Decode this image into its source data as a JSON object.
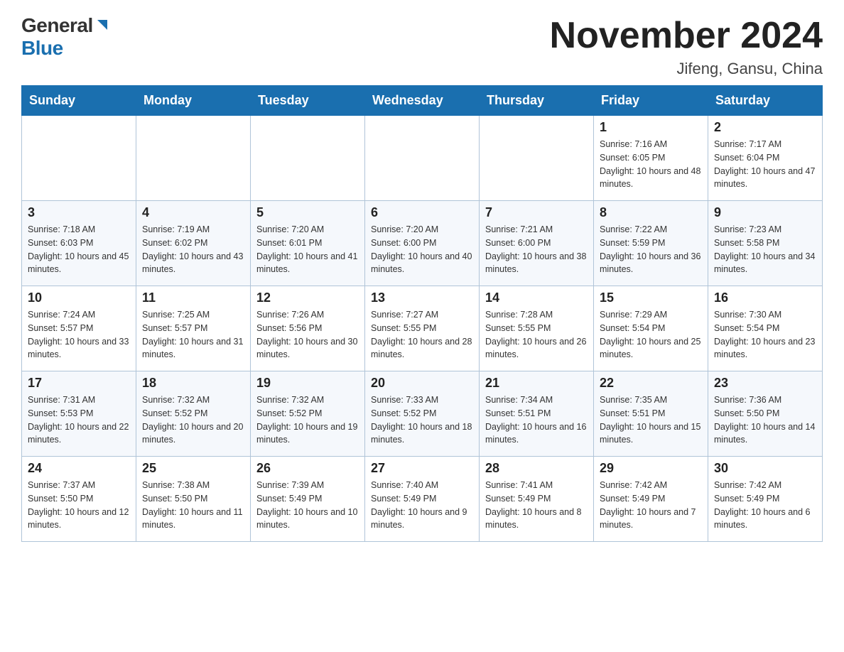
{
  "logo": {
    "general": "General",
    "blue": "Blue"
  },
  "title": "November 2024",
  "location": "Jifeng, Gansu, China",
  "weekdays": [
    "Sunday",
    "Monday",
    "Tuesday",
    "Wednesday",
    "Thursday",
    "Friday",
    "Saturday"
  ],
  "weeks": [
    [
      {
        "day": "",
        "info": ""
      },
      {
        "day": "",
        "info": ""
      },
      {
        "day": "",
        "info": ""
      },
      {
        "day": "",
        "info": ""
      },
      {
        "day": "",
        "info": ""
      },
      {
        "day": "1",
        "info": "Sunrise: 7:16 AM\nSunset: 6:05 PM\nDaylight: 10 hours and 48 minutes."
      },
      {
        "day": "2",
        "info": "Sunrise: 7:17 AM\nSunset: 6:04 PM\nDaylight: 10 hours and 47 minutes."
      }
    ],
    [
      {
        "day": "3",
        "info": "Sunrise: 7:18 AM\nSunset: 6:03 PM\nDaylight: 10 hours and 45 minutes."
      },
      {
        "day": "4",
        "info": "Sunrise: 7:19 AM\nSunset: 6:02 PM\nDaylight: 10 hours and 43 minutes."
      },
      {
        "day": "5",
        "info": "Sunrise: 7:20 AM\nSunset: 6:01 PM\nDaylight: 10 hours and 41 minutes."
      },
      {
        "day": "6",
        "info": "Sunrise: 7:20 AM\nSunset: 6:00 PM\nDaylight: 10 hours and 40 minutes."
      },
      {
        "day": "7",
        "info": "Sunrise: 7:21 AM\nSunset: 6:00 PM\nDaylight: 10 hours and 38 minutes."
      },
      {
        "day": "8",
        "info": "Sunrise: 7:22 AM\nSunset: 5:59 PM\nDaylight: 10 hours and 36 minutes."
      },
      {
        "day": "9",
        "info": "Sunrise: 7:23 AM\nSunset: 5:58 PM\nDaylight: 10 hours and 34 minutes."
      }
    ],
    [
      {
        "day": "10",
        "info": "Sunrise: 7:24 AM\nSunset: 5:57 PM\nDaylight: 10 hours and 33 minutes."
      },
      {
        "day": "11",
        "info": "Sunrise: 7:25 AM\nSunset: 5:57 PM\nDaylight: 10 hours and 31 minutes."
      },
      {
        "day": "12",
        "info": "Sunrise: 7:26 AM\nSunset: 5:56 PM\nDaylight: 10 hours and 30 minutes."
      },
      {
        "day": "13",
        "info": "Sunrise: 7:27 AM\nSunset: 5:55 PM\nDaylight: 10 hours and 28 minutes."
      },
      {
        "day": "14",
        "info": "Sunrise: 7:28 AM\nSunset: 5:55 PM\nDaylight: 10 hours and 26 minutes."
      },
      {
        "day": "15",
        "info": "Sunrise: 7:29 AM\nSunset: 5:54 PM\nDaylight: 10 hours and 25 minutes."
      },
      {
        "day": "16",
        "info": "Sunrise: 7:30 AM\nSunset: 5:54 PM\nDaylight: 10 hours and 23 minutes."
      }
    ],
    [
      {
        "day": "17",
        "info": "Sunrise: 7:31 AM\nSunset: 5:53 PM\nDaylight: 10 hours and 22 minutes."
      },
      {
        "day": "18",
        "info": "Sunrise: 7:32 AM\nSunset: 5:52 PM\nDaylight: 10 hours and 20 minutes."
      },
      {
        "day": "19",
        "info": "Sunrise: 7:32 AM\nSunset: 5:52 PM\nDaylight: 10 hours and 19 minutes."
      },
      {
        "day": "20",
        "info": "Sunrise: 7:33 AM\nSunset: 5:52 PM\nDaylight: 10 hours and 18 minutes."
      },
      {
        "day": "21",
        "info": "Sunrise: 7:34 AM\nSunset: 5:51 PM\nDaylight: 10 hours and 16 minutes."
      },
      {
        "day": "22",
        "info": "Sunrise: 7:35 AM\nSunset: 5:51 PM\nDaylight: 10 hours and 15 minutes."
      },
      {
        "day": "23",
        "info": "Sunrise: 7:36 AM\nSunset: 5:50 PM\nDaylight: 10 hours and 14 minutes."
      }
    ],
    [
      {
        "day": "24",
        "info": "Sunrise: 7:37 AM\nSunset: 5:50 PM\nDaylight: 10 hours and 12 minutes."
      },
      {
        "day": "25",
        "info": "Sunrise: 7:38 AM\nSunset: 5:50 PM\nDaylight: 10 hours and 11 minutes."
      },
      {
        "day": "26",
        "info": "Sunrise: 7:39 AM\nSunset: 5:49 PM\nDaylight: 10 hours and 10 minutes."
      },
      {
        "day": "27",
        "info": "Sunrise: 7:40 AM\nSunset: 5:49 PM\nDaylight: 10 hours and 9 minutes."
      },
      {
        "day": "28",
        "info": "Sunrise: 7:41 AM\nSunset: 5:49 PM\nDaylight: 10 hours and 8 minutes."
      },
      {
        "day": "29",
        "info": "Sunrise: 7:42 AM\nSunset: 5:49 PM\nDaylight: 10 hours and 7 minutes."
      },
      {
        "day": "30",
        "info": "Sunrise: 7:42 AM\nSunset: 5:49 PM\nDaylight: 10 hours and 6 minutes."
      }
    ]
  ]
}
